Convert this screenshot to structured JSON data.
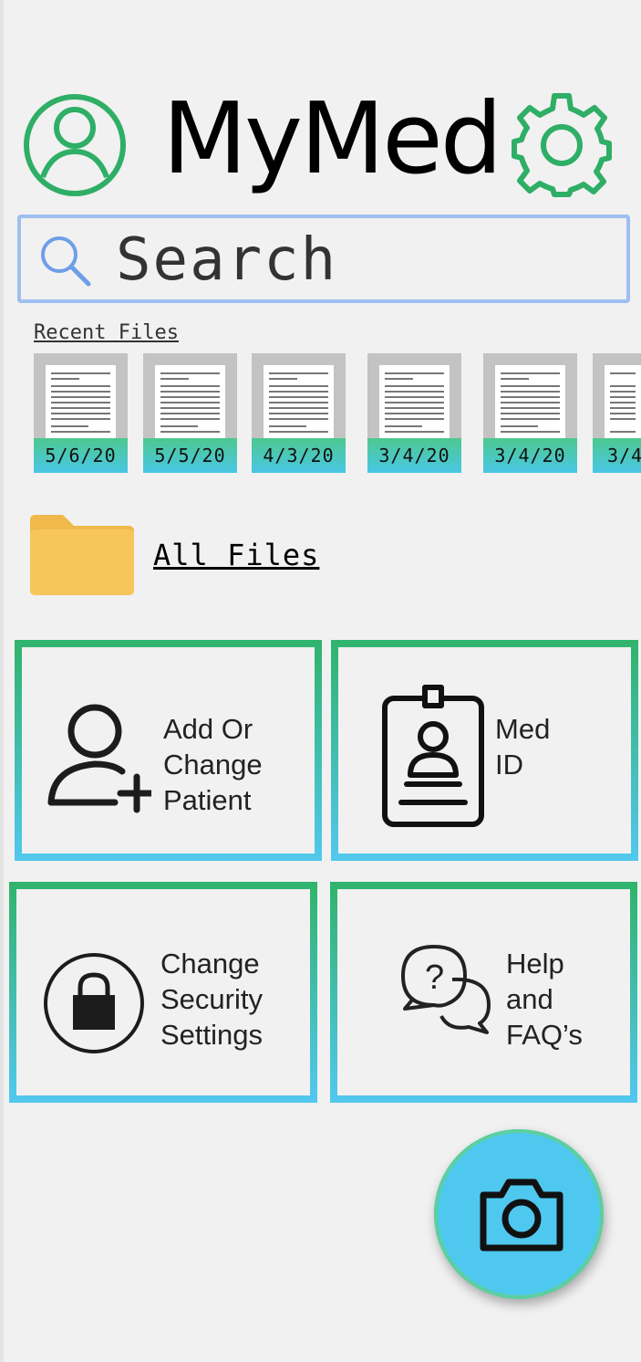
{
  "app": {
    "title": "MyMed"
  },
  "header": {
    "profile_icon": "user-circle-icon",
    "settings_icon": "gear-icon"
  },
  "search": {
    "placeholder": "Search",
    "icon": "search-icon"
  },
  "recent": {
    "label": "Recent Files",
    "files": [
      {
        "date": "5/6/20"
      },
      {
        "date": "5/5/20"
      },
      {
        "date": "4/3/20"
      },
      {
        "date": "3/4/20"
      },
      {
        "date": "3/4/20"
      },
      {
        "date": "3/4"
      }
    ]
  },
  "all_files": {
    "label": "All Files",
    "icon": "folder-icon"
  },
  "tiles": [
    {
      "label": "Add Or\nChange\nPatient",
      "icon": "add-user-icon"
    },
    {
      "label": "Med\nID",
      "icon": "id-badge-icon"
    },
    {
      "label": "Change\nSecurity\nSettings",
      "icon": "lock-icon"
    },
    {
      "label": "Help\nand\nFAQ’s",
      "icon": "help-chat-icon"
    }
  ],
  "fab": {
    "icon": "camera-icon"
  },
  "colors": {
    "green": "#2fb36b",
    "blue": "#52c8ee",
    "search_border": "#9ebff0",
    "folder": "#f6c65a"
  }
}
